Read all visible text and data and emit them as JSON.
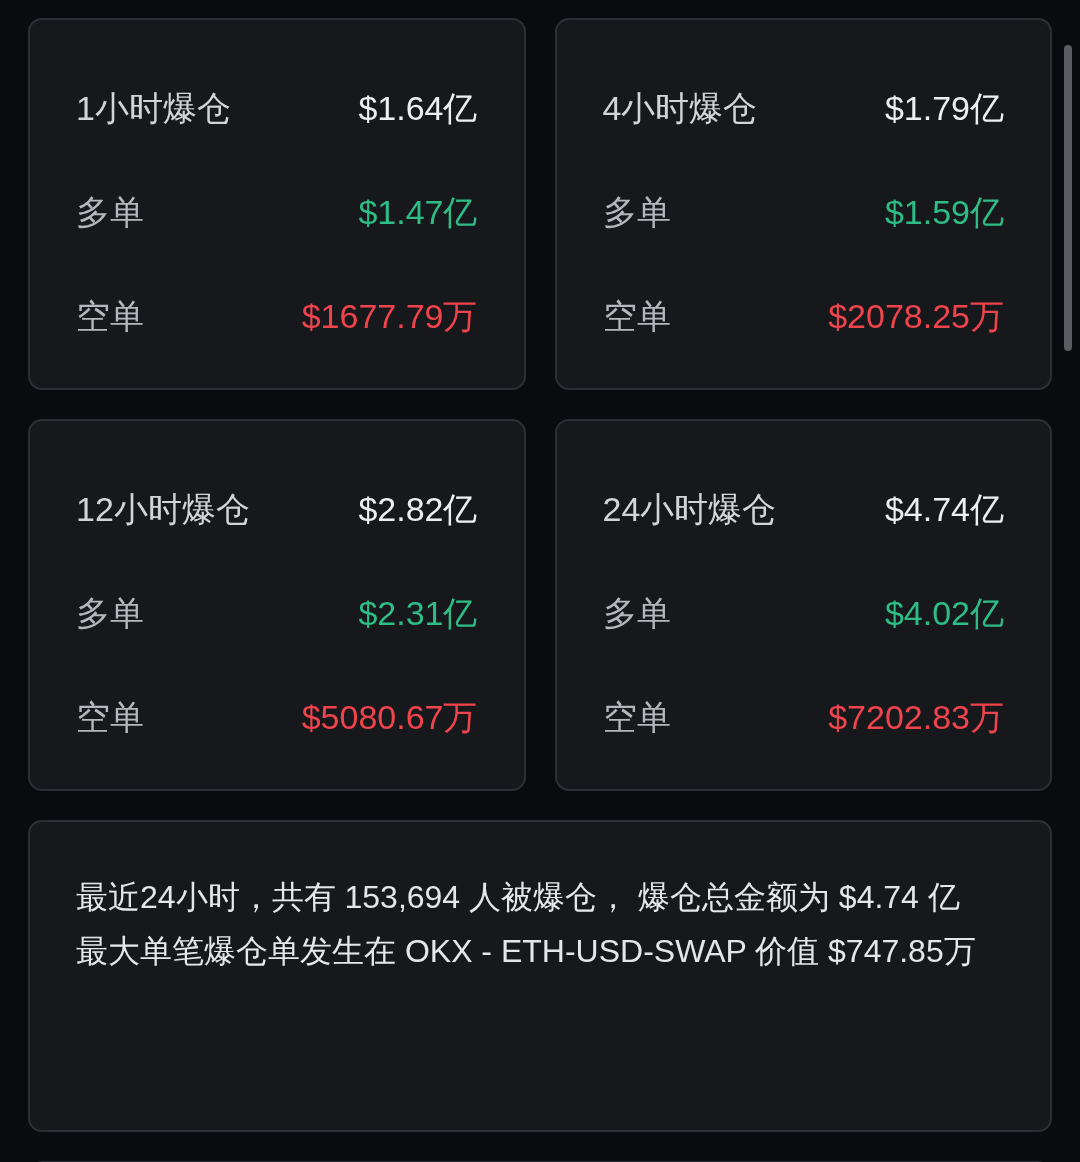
{
  "cards": [
    {
      "title": "1小时爆仓",
      "total": "$1.64亿",
      "rows": [
        {
          "kind": "long",
          "label": "多单",
          "value": "$1.47亿"
        },
        {
          "kind": "short",
          "label": "空单",
          "value": "$1677.79万"
        }
      ]
    },
    {
      "title": "4小时爆仓",
      "total": "$1.79亿",
      "rows": [
        {
          "kind": "long",
          "label": "多单",
          "value": "$1.59亿"
        },
        {
          "kind": "short",
          "label": "空单",
          "value": "$2078.25万"
        }
      ]
    },
    {
      "title": "12小时爆仓",
      "total": "$2.82亿",
      "rows": [
        {
          "kind": "long",
          "label": "多单",
          "value": "$2.31亿"
        },
        {
          "kind": "short",
          "label": "空单",
          "value": "$5080.67万"
        }
      ]
    },
    {
      "title": "24小时爆仓",
      "total": "$4.74亿",
      "rows": [
        {
          "kind": "long",
          "label": "多单",
          "value": "$4.02亿"
        },
        {
          "kind": "short",
          "label": "空单",
          "value": "$7202.83万"
        }
      ]
    }
  ],
  "summary": [
    "最近24小时，共有 153,694 人被爆仓， 爆仓总金额为 $4.74 亿",
    "最大单笔爆仓单发生在 OKX - ETH-USD-SWAP 价值 $747.85万"
  ]
}
